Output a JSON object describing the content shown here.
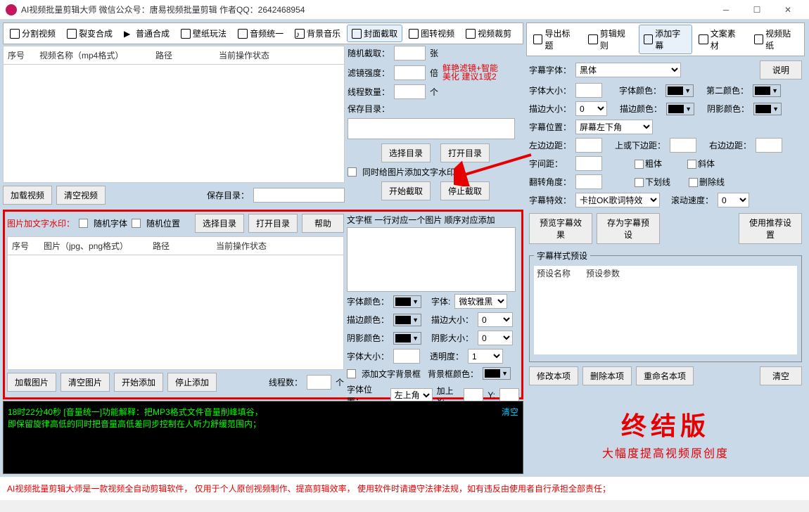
{
  "title": "AI视频批量剪辑大师    微信公众号：唐易视频批量剪辑    作者QQ：2642468954",
  "left_tabs": [
    "分割视频",
    "裂变合成",
    "普通合成",
    "壁纸玩法",
    "音频统一",
    "背景音乐",
    "封面截取",
    "图转视频",
    "视频裁剪"
  ],
  "right_tabs": [
    "导出标题",
    "剪辑规则",
    "添加字幕",
    "文案素材",
    "视频贴纸"
  ],
  "tbl1_headers": {
    "c1": "序号",
    "c2": "视频名称（mp4格式）",
    "c3": "路径",
    "c4": "当前操作状态"
  },
  "tbl2_headers": {
    "c1": "序号",
    "c2": "图片（jpg、png格式）",
    "c3": "路径",
    "c4": "当前操作状态"
  },
  "btns": {
    "load_video": "加载视频",
    "clear_video": "清空视频",
    "save_dir": "保存目录：",
    "sel_dir": "选择目录",
    "open_dir": "打开目录",
    "start_cap": "开始截取",
    "stop_cap": "停止截取",
    "load_img": "加载图片",
    "clear_img": "清空图片",
    "start_add": "开始添加",
    "stop_add": "停止添加",
    "help": "帮助",
    "preview_sub": "预览字幕效果",
    "save_preset": "存为字幕预设",
    "use_rec": "使用推荐设置",
    "mod": "修改本项",
    "del": "删除本项",
    "rename": "重命名本项",
    "clear": "清空",
    "desc": "说明",
    "log_clear": "清空"
  },
  "cover": {
    "rand_cap": "随机截取：",
    "zhang": "张",
    "filter": "滤镜强度：",
    "bei": "倍",
    "hint1": "鲜艳滤镜+智能",
    "hint2": "美化 建议1或2",
    "threads": "线程数量：",
    "ge": "个",
    "savedir": "保存目录：",
    "watermark_cb": "同时给图片添加文字水印"
  },
  "wm": {
    "title": "图片加文字水印：",
    "rand_font": "随机字体",
    "rand_pos": "随机位置",
    "threads": "线程数：",
    "ge": "个",
    "textbox_hint": "文字框 一行对应一个图片 顺序对应添加",
    "font_color": "字体颜色：",
    "font": "字体:",
    "font_val": "微软雅黑",
    "stroke_color": "描边颜色：",
    "stroke_size": "描边大小：",
    "stroke_val": "0",
    "shadow_color": "阴影颜色：",
    "shadow_size": "阴影大小：",
    "shadow_val": "0",
    "font_size": "字体大小：",
    "opacity": "透明度：",
    "opacity_val": "1",
    "bg_cb": "添加文字背景框",
    "bg_color": "背景框颜色：",
    "pos": "字体位置：",
    "pos_val": "左上角",
    "addx": "加上X:",
    "y": "Y:"
  },
  "sub": {
    "font": "字幕字体：",
    "font_val": "黑体",
    "size": "字体大小：",
    "color": "字体颜色：",
    "color2": "第二颜色：",
    "stroke": "描边大小：",
    "stroke_val": "0",
    "stroke_c": "描边颜色：",
    "shadow_c": "阴影颜色：",
    "pos": "字幕位置：",
    "pos_val": "屏幕左下角",
    "ml": "左边边距：",
    "mv": "上或下边距：",
    "mr": "右边边距：",
    "spacing": "字间距：",
    "bold": "粗体",
    "italic": "斜体",
    "rot": "翻转角度：",
    "under": "下划线",
    "strike": "删除线",
    "fx": "字幕特效：",
    "fx_val": "卡拉OK歌词特效",
    "speed": "滚动速度：",
    "speed_val": "0",
    "preset_legend": "字幕样式预设",
    "preset_h1": "预设名称",
    "preset_h2": "预设参数"
  },
  "log": {
    "l1": "18时22分40秒 [音量统一]功能解释：把MP3格式文件音量削峰填谷，",
    "l2": "      即保留旋律高低的同时把音量高低差同步控制在人听力舒缓范围内；"
  },
  "brand": {
    "big": "终结版",
    "sub": "大幅度提高视频原创度"
  },
  "footer": "AI视频批量剪辑大师是一款视频全自动剪辑软件，  仅用于个人原创视频制作、提高剪辑效率，  使用软件时请遵守法律法规，如有违反由使用者自行承担全部责任；"
}
